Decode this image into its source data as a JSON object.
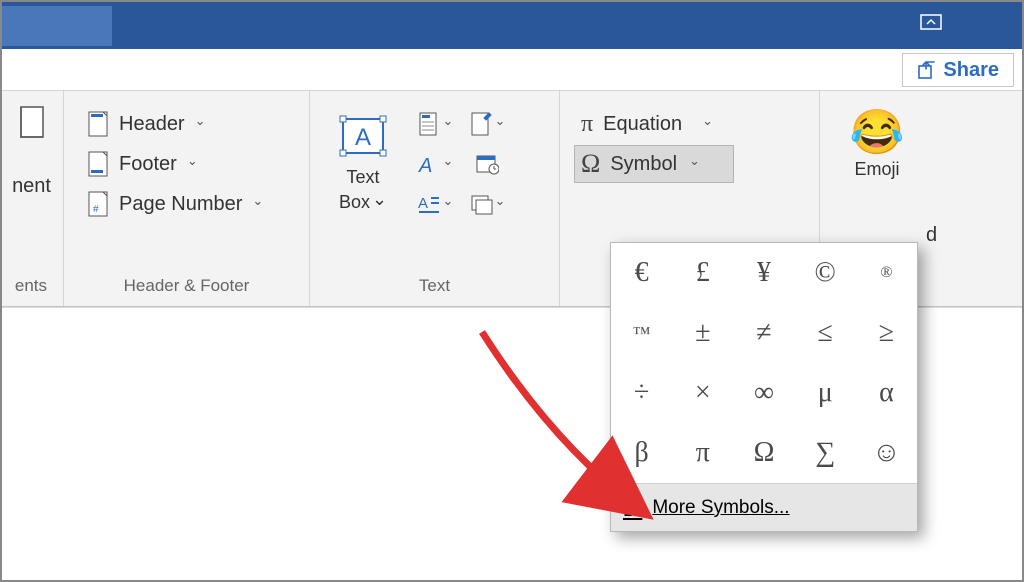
{
  "titlebar": {},
  "share": {
    "label": "Share"
  },
  "ribbon": {
    "partial_left": {
      "group_label_fragment": "ents",
      "item_fragment": "nent"
    },
    "header_footer": {
      "header": "Header",
      "footer": "Footer",
      "page_number": "Page Number",
      "group_label": "Header & Footer"
    },
    "text": {
      "text_box": "Text\nBox",
      "group_label": "Text"
    },
    "symbols": {
      "equation": "Equation",
      "symbol": "Symbol"
    },
    "emoji": {
      "label": "Emoji",
      "right_fragment": "d"
    }
  },
  "symbol_panel": {
    "grid": [
      "€",
      "£",
      "¥",
      "©",
      "®",
      "™",
      "±",
      "≠",
      "≤",
      "≥",
      "÷",
      "×",
      "∞",
      "μ",
      "α",
      "β",
      "π",
      "Ω",
      "∑",
      "☺"
    ],
    "more": "More Symbols..."
  }
}
